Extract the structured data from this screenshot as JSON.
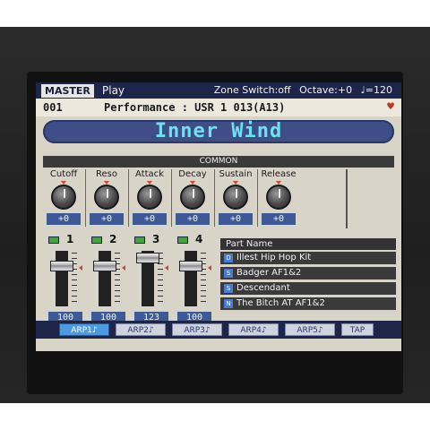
{
  "status": {
    "mode": "MASTER",
    "page": "Play",
    "zone_switch": "Zone Switch:off",
    "octave": "Octave:+0",
    "tempo": "♩=120"
  },
  "performance": {
    "number": "001",
    "label": "Performance : USR 1 013(A13)",
    "favorite_icon": "heart-icon"
  },
  "name": "Inner Wind",
  "common_label": "COMMON",
  "knobs": [
    {
      "label": "Cutoff",
      "value": "+0"
    },
    {
      "label": "Reso",
      "value": "+0"
    },
    {
      "label": "Attack",
      "value": "+0"
    },
    {
      "label": "Decay",
      "value": "+0"
    },
    {
      "label": "Sustain",
      "value": "+0"
    },
    {
      "label": "Release",
      "value": "+0"
    }
  ],
  "parts": [
    {
      "number": "1",
      "volume": "100"
    },
    {
      "number": "2",
      "volume": "100"
    },
    {
      "number": "3",
      "volume": "123"
    },
    {
      "number": "4",
      "volume": "100"
    }
  ],
  "part_list": {
    "header": "Part Name",
    "items": [
      {
        "badge": "D",
        "name": "Illest Hip Hop Kit"
      },
      {
        "badge": "S",
        "name": "Badger AF1&2"
      },
      {
        "badge": "S",
        "name": "Descendant"
      },
      {
        "badge": "N",
        "name": "The Bitch AT AF1&2"
      }
    ]
  },
  "arp_tabs": [
    "ARP1♪",
    "ARP2♪",
    "ARP3♪",
    "ARP4♪",
    "ARP5♪",
    "TAP"
  ],
  "active_arp": 0,
  "colors": {
    "accent": "#6fe0f0",
    "banner": "#3d4f86",
    "active_tab": "#4c9be0"
  }
}
